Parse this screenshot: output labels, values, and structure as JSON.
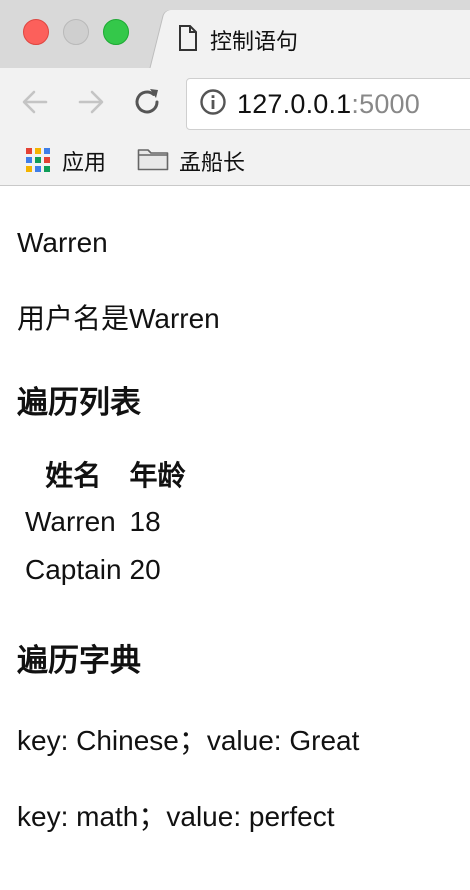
{
  "browser": {
    "tab_title": "控制语句",
    "url_host": "127.0.0.1",
    "url_port": ":5000",
    "bookmarks": {
      "apps_label": "应用",
      "folder_label": "孟船长"
    },
    "icons": {
      "tab": "page-icon",
      "back": "arrow-left-icon",
      "forward": "arrow-right-icon",
      "reload": "reload-icon",
      "info": "info-icon",
      "apps": "apps-grid-icon",
      "folder": "folder-icon"
    },
    "colors": {
      "close": "#fc605b",
      "minimize": "#cfcfcf",
      "maximize": "#34c84a"
    }
  },
  "page": {
    "name": "Warren",
    "username_line": "用户名是Warren",
    "list_heading": "遍历列表",
    "table": {
      "headers": [
        "姓名",
        "年龄"
      ],
      "rows": [
        [
          "Warren",
          "18"
        ],
        [
          "Captain",
          "20"
        ]
      ]
    },
    "dict_heading": "遍历字典",
    "dict_items": [
      "key: Chinese；value: Great",
      "key: math；value: perfect"
    ]
  }
}
